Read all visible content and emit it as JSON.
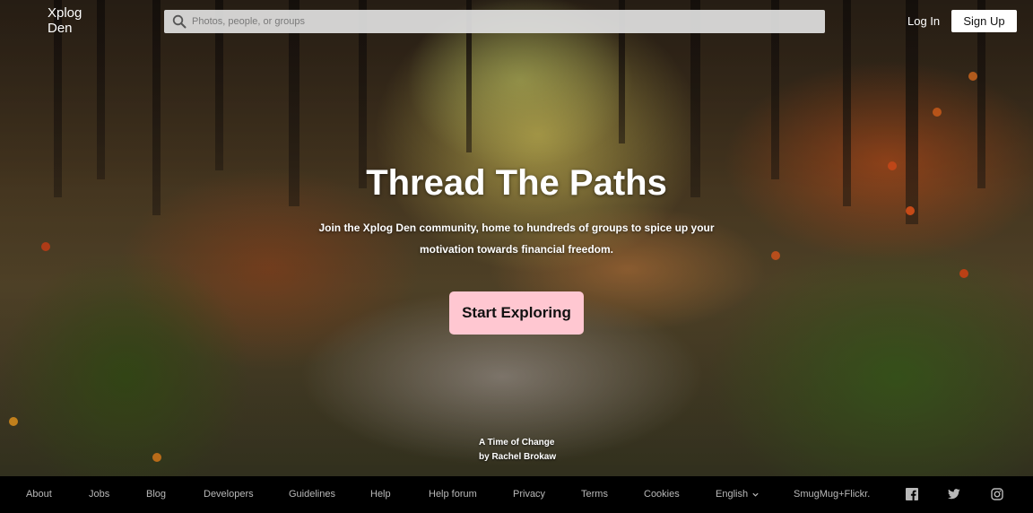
{
  "header": {
    "logo": "Xplog Den",
    "search_placeholder": "Photos, people, or groups",
    "login_label": "Log In",
    "signup_label": "Sign Up"
  },
  "hero": {
    "title": "Thread The Paths",
    "subtitle": "Join the Xplog Den community, home to hundreds of groups to spice up your motivation towards financial freedom.",
    "cta_label": "Start Exploring",
    "photo_title": "A Time of Change",
    "photo_author": "by Rachel Brokaw"
  },
  "footer": {
    "links": [
      "About",
      "Jobs",
      "Blog",
      "Developers",
      "Guidelines",
      "Help",
      "Help forum",
      "Privacy",
      "Terms",
      "Cookies"
    ],
    "language": "English",
    "brand": "SmugMug+Flickr.",
    "social_icons": [
      "facebook-icon",
      "twitter-icon",
      "instagram-icon"
    ]
  },
  "colors": {
    "cta_background": "#ffc7d1",
    "footer_background": "#000000",
    "footer_text": "#b9b9b9"
  }
}
